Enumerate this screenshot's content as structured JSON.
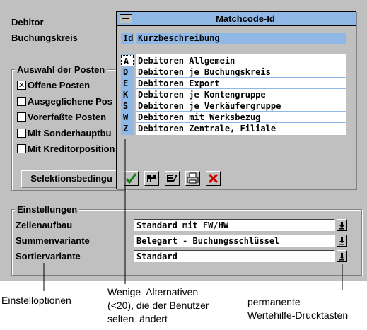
{
  "screen": {
    "labels": {
      "debitor": "Debitor",
      "buchungskreis": "Buchungskreis"
    },
    "auswahl": {
      "title": "Auswahl der Posten",
      "options": [
        {
          "label": "Offene Posten",
          "checked": true
        },
        {
          "label": "Ausgeglichene Pos",
          "checked": false
        },
        {
          "label": "Vorerfaßte Posten",
          "checked": false
        },
        {
          "label": "Mit Sonderhauptbu",
          "checked": false
        },
        {
          "label": "Mit Kreditorposition",
          "checked": false
        }
      ],
      "button_label": "Selektionsbedingu"
    },
    "einstellungen": {
      "title": "Einstellungen",
      "fields": [
        {
          "label": "Zeilenaufbau",
          "value": "Standard mit FW/HW"
        },
        {
          "label": "Summenvariante",
          "value": "Belegart - Buchungsschlüssel"
        },
        {
          "label": "Sortiervariante",
          "value": "Standard"
        }
      ]
    }
  },
  "popup": {
    "title": "Matchcode-Id",
    "header": {
      "id": "Id",
      "description": "Kurzbeschreibung"
    },
    "rows": [
      {
        "key": "A",
        "text": "Debitoren Allgemein"
      },
      {
        "key": "D",
        "text": "Debitoren je Buchungskreis"
      },
      {
        "key": "E",
        "text": "Debitoren Export"
      },
      {
        "key": "K",
        "text": "Debitoren je Kontengruppe"
      },
      {
        "key": "S",
        "text": "Debitoren je Verkäufergruppe"
      },
      {
        "key": "W",
        "text": "Debitoren mit Werksbezug"
      },
      {
        "key": "Z",
        "text": "Debitoren Zentrale, Filiale"
      }
    ],
    "toolbar": [
      "check-icon",
      "binoculars-icon",
      "select-icon",
      "print-icon",
      "cancel-icon"
    ]
  },
  "annotations": {
    "left": "Einstelloptionen",
    "middle": [
      "Wenige  Alternativen",
      "(<20), die der Benutzer",
      "selten  ändert"
    ],
    "right": [
      "permanente",
      "Wertehilfe-Drucktasten"
    ]
  },
  "colors": {
    "window_bg": "#c0c0c0",
    "highlight": "#8fb8e6",
    "cancel_red": "#d00000",
    "check_green": "#108010"
  }
}
